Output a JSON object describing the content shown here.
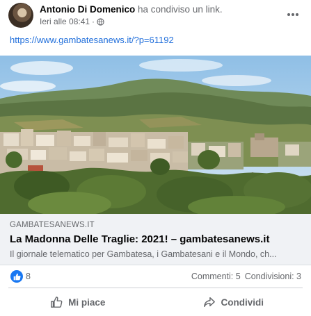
{
  "post": {
    "author": "Antonio Di Domenico",
    "action": "ha condiviso un link.",
    "time": "Ieri alle 08:41",
    "separator": "·",
    "link_url": "https://www.gambatesanews.it/?p=61192"
  },
  "card": {
    "domain": "GAMBATESANEWS.IT",
    "title": "La Madonna Delle Traglie: 2021! – gambatesanews.it",
    "description": "Il giornale telematico per Gambatesa, i Gambatesani e il Mondo, ch..."
  },
  "reactions": {
    "like_count": "8",
    "comments": "Commenti: 5",
    "shares": "Condivisioni: 3"
  },
  "actions": {
    "like_label": "Mi piace",
    "share_label": "Condividi"
  },
  "icons": {
    "menu": "more-horizontal-icon",
    "privacy": "globe-icon",
    "like": "thumbs-up-icon",
    "share": "share-arrow-icon"
  },
  "colors": {
    "link": "#216fdb",
    "brand": "#1877f2",
    "secondary_text": "#65676b",
    "card_bg": "#f0f2f5"
  }
}
